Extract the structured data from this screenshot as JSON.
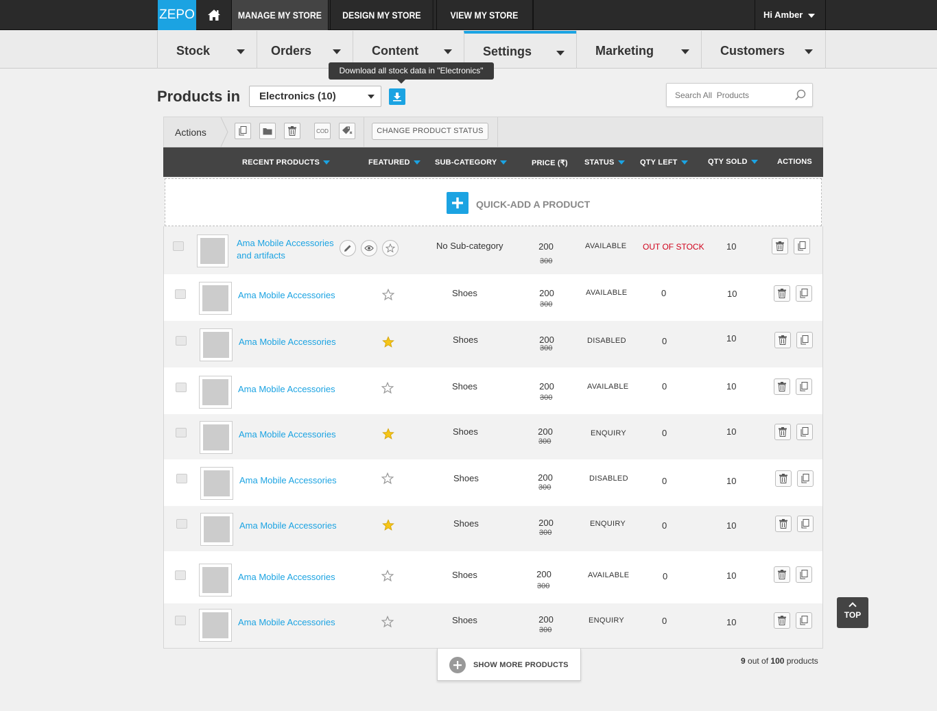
{
  "topbar": {
    "logo": "ZEPO",
    "nav": [
      "MANAGE MY STORE",
      "DESIGN MY STORE",
      "VIEW MY STORE"
    ],
    "user": "Hi Amber"
  },
  "subnav": {
    "items": [
      "Stock",
      "Orders",
      "Content",
      "Settings",
      "Marketing",
      "Customers"
    ],
    "active": "Settings"
  },
  "tooltip": "Download all stock data in \"Electronics\"",
  "header": {
    "title": "Products in",
    "category": "Electronics (10)",
    "search_placeholder": "Search All  Products"
  },
  "actions": {
    "label": "Actions",
    "cod_label": "COD",
    "change_status": "CHANGE PRODUCT STATUS"
  },
  "columns": {
    "recent": "RECENT PRODUCTS",
    "featured": "FEATURED",
    "subcategory": "SUB-CATEGORY",
    "price": "PRICE (₹)",
    "status": "STATUS",
    "qty_left": "QTY LEFT",
    "qty_sold": "QTY SOLD",
    "actions": "ACTIONS"
  },
  "quick_add": "QUICK-ADD A PRODUCT",
  "colors": {
    "accent": "#1ba3e2",
    "out_of_stock": "#d0021b",
    "star": "#f5c518"
  },
  "rows": [
    {
      "name_line1": "Ama Mobile Accessories",
      "name_line2": "and artifacts",
      "featured": false,
      "subcategory": "No Sub-category",
      "price": "200",
      "old_price": "300",
      "status": "AVAILABLE",
      "qty_left": "OUT OF STOCK",
      "qty_sold": "10"
    },
    {
      "name": "Ama Mobile Accessories",
      "featured": false,
      "subcategory": "Shoes",
      "price": "200",
      "old_price": "300",
      "status": "AVAILABLE",
      "qty_left": "0",
      "qty_sold": "10"
    },
    {
      "name": "Ama Mobile Accessories",
      "featured": true,
      "subcategory": "Shoes",
      "price": "200",
      "old_price": "300",
      "status": "DISABLED",
      "qty_left": "0",
      "qty_sold": "10"
    },
    {
      "name": "Ama Mobile Accessories",
      "featured": false,
      "subcategory": "Shoes",
      "price": "200",
      "old_price": "300",
      "status": "AVAILABLE",
      "qty_left": "0",
      "qty_sold": "10"
    },
    {
      "name": "Ama Mobile Accessories",
      "featured": true,
      "subcategory": "Shoes",
      "price": "200",
      "old_price": "300",
      "status": "ENQUIRY",
      "qty_left": "0",
      "qty_sold": "10"
    },
    {
      "name": "Ama Mobile Accessories",
      "featured": false,
      "subcategory": "Shoes",
      "price": "200",
      "old_price": "300",
      "status": "DISABLED",
      "qty_left": "0",
      "qty_sold": "10"
    },
    {
      "name": "Ama Mobile Accessories",
      "featured": true,
      "subcategory": "Shoes",
      "price": "200",
      "old_price": "300",
      "status": "ENQUIRY",
      "qty_left": "0",
      "qty_sold": "10"
    },
    {
      "name": "Ama Mobile Accessories",
      "featured": false,
      "subcategory": "Shoes",
      "price": "200",
      "old_price": "300",
      "status": "AVAILABLE",
      "qty_left": "0",
      "qty_sold": "10"
    },
    {
      "name": "Ama Mobile Accessories",
      "featured": false,
      "subcategory": "Shoes",
      "price": "200",
      "old_price": "300",
      "status": "ENQUIRY",
      "qty_left": "0",
      "qty_sold": "10"
    }
  ],
  "footer": {
    "show_more": "SHOW MORE PRODUCTS",
    "shown": "9",
    "count_mid": " out of ",
    "total": "100",
    "count_suffix": " products",
    "top": "TOP"
  }
}
